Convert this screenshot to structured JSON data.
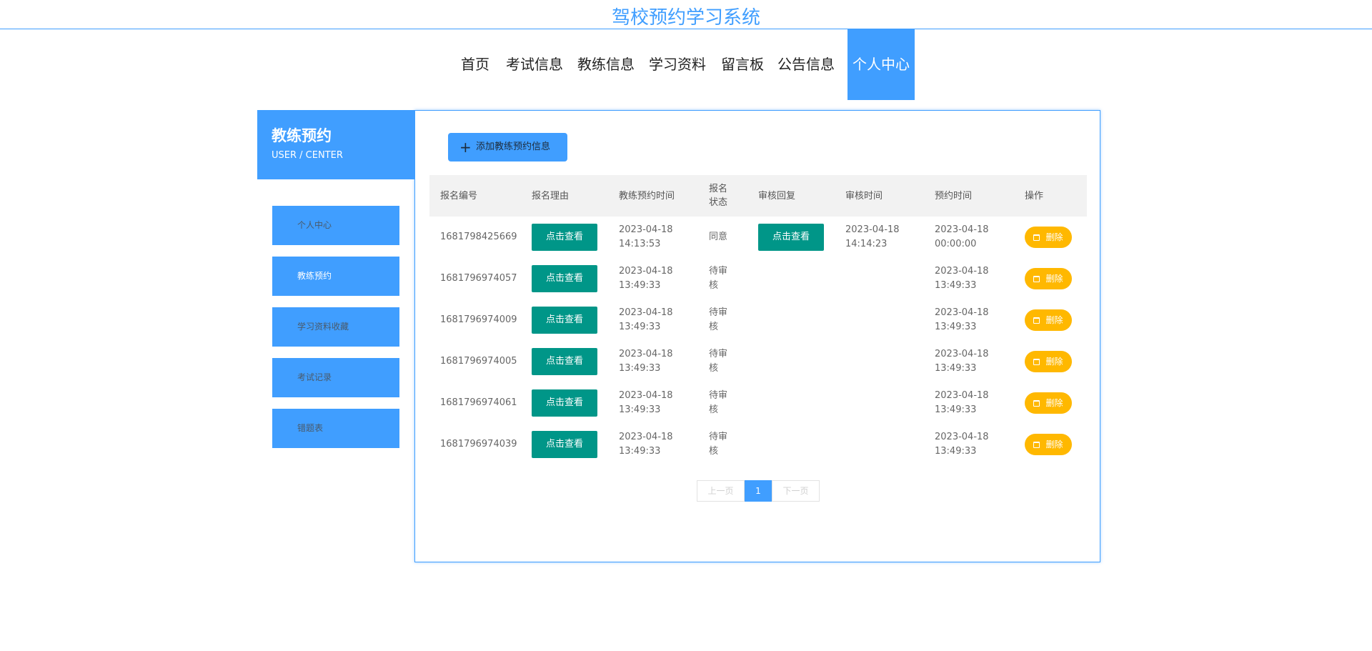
{
  "site": {
    "title": "驾校预约学习系统"
  },
  "nav": {
    "items": [
      {
        "label": "首页"
      },
      {
        "label": "考试信息"
      },
      {
        "label": "教练信息"
      },
      {
        "label": "学习资料"
      },
      {
        "label": "留言板"
      },
      {
        "label": "公告信息"
      },
      {
        "label": "个人中心"
      }
    ],
    "active_index": 6
  },
  "sidebar": {
    "title": "教练预约",
    "subtitle": "USER / CENTER",
    "items": [
      {
        "label": "个人中心"
      },
      {
        "label": "教练预约"
      },
      {
        "label": "学习资料收藏"
      },
      {
        "label": "考试记录"
      },
      {
        "label": "错题表"
      }
    ],
    "active_index": 1
  },
  "main": {
    "add_button": {
      "label": "添加教练预约信息",
      "icon": "plus-icon"
    },
    "table": {
      "headers": [
        "报名编号",
        "报名理由",
        "教练预约时间",
        "报名状态",
        "审核回复",
        "审核时间",
        "预约时间",
        "操作"
      ],
      "view_label": "点击查看",
      "delete_label": "删除",
      "delete_icon": "trash-icon",
      "rows": [
        {
          "id": "1681798425669",
          "apply_time": "2023-04-18 14:13:53",
          "status": "同意",
          "has_reply": true,
          "review_time": "2023-04-18 14:14:23",
          "appoint_time": "2023-04-18 00:00:00"
        },
        {
          "id": "1681796974057",
          "apply_time": "2023-04-18 13:49:33",
          "status": "待审核",
          "has_reply": false,
          "review_time": "",
          "appoint_time": "2023-04-18 13:49:33"
        },
        {
          "id": "1681796974009",
          "apply_time": "2023-04-18 13:49:33",
          "status": "待审核",
          "has_reply": false,
          "review_time": "",
          "appoint_time": "2023-04-18 13:49:33"
        },
        {
          "id": "1681796974005",
          "apply_time": "2023-04-18 13:49:33",
          "status": "待审核",
          "has_reply": false,
          "review_time": "",
          "appoint_time": "2023-04-18 13:49:33"
        },
        {
          "id": "1681796974061",
          "apply_time": "2023-04-18 13:49:33",
          "status": "待审核",
          "has_reply": false,
          "review_time": "",
          "appoint_time": "2023-04-18 13:49:33"
        },
        {
          "id": "1681796974039",
          "apply_time": "2023-04-18 13:49:33",
          "status": "待审核",
          "has_reply": false,
          "review_time": "",
          "appoint_time": "2023-04-18 13:49:33"
        }
      ]
    },
    "pagination": {
      "prev_label": "上一页",
      "current": "1",
      "next_label": "下一页"
    }
  },
  "colors": {
    "primary": "#409EFF",
    "view_button": "#009688",
    "delete_button": "#FFB800"
  }
}
